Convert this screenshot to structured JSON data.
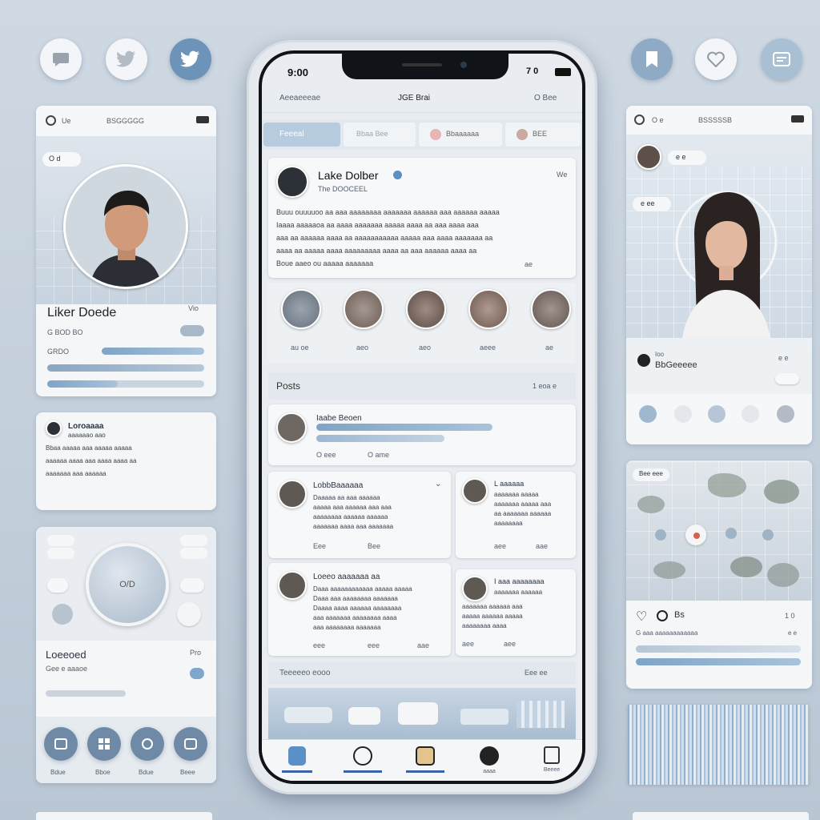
{
  "social_icons_left": [
    "chat-bubble-icon",
    "twitter-bird-icon",
    "twitter-bird-icon"
  ],
  "social_icons_right": [
    "bookmark-icon",
    "heart-icon",
    "message-icon"
  ],
  "left_profile": {
    "status_left": "Ue",
    "status_title": "BSGGGGG",
    "tag": "O d",
    "name": "Liker Doede",
    "name_meta": "Vio",
    "row1": "G BOD BO",
    "row2": "GRDO"
  },
  "left_post": {
    "name": "Loroaaaa",
    "lines": [
      "aaaaaao aao",
      "Bbaa aaaaa aaa aaaaa aaaaa",
      "aaaaaa aaaa aaa aaaa aaaa aa",
      "aaaaaaa aaa aaaaaa"
    ]
  },
  "left_media": {
    "label": "Loeeoed",
    "sub": "Gee e aaaoe",
    "meta": "Pro",
    "center_label": "O/D",
    "icons": [
      "play-icon",
      "grid-icon",
      "share-icon",
      "bookmark-icon"
    ],
    "icon_labels": [
      "Bdue",
      "Bboe",
      "Bdue",
      "Beee"
    ]
  },
  "phone": {
    "time": "9:00",
    "status_right": "7 0",
    "header_left": "Aeeaeeeae",
    "header_center": "JGE Brai",
    "header_right": "O Bee",
    "tabs": [
      "Feeeal",
      "Bbaa Bee",
      "Bbaaaaaa",
      "BEE"
    ],
    "post": {
      "author": "Lake Dolber",
      "subtitle": "The DOOCEEL",
      "time": "We",
      "lines": [
        "Buuu ouuuuoo aa aaa aaaaaaaa aaaaaaa aaaaaa aaa aaaaaa aaaaa",
        "Iaaaa aaaaaoa aa aaaa aaaaaaa aaaaa aaaa aa aaa aaaa aaa",
        "aaa aa aaaaaa aaaa aa aaaaaaaaaaa aaaaa aaa aaaa aaaaaaa aa",
        "aaaa aa aaaaa aaaa aaaaaaaaa aaaa aa aaa aaaaaa aaaa aa",
        "Boue aaeo ou aaaaa aaaaaaa"
      ],
      "action": "ae"
    },
    "stories": [
      "au oe",
      "aeo",
      "aeo",
      "aeee",
      "ae"
    ],
    "posts_label": "Posts",
    "posts_meta": "1 eoa e",
    "feed": [
      {
        "author": "Iaabe Beoen",
        "l1": "O eee",
        "l2": "O ame"
      },
      {
        "author": "LobbBaaaaaa",
        "lines": [
          "Daaaaa aa aaa aaaaaa",
          "aaaaa aaa aaaaaa aaa aaa",
          "aaaaaaaa aaaaaa aaaaaa",
          "aaaaaaa aaaa aaa aaaaaaa"
        ],
        "a1": "Eee",
        "a2": "Bee"
      },
      {
        "author": "L aaaaaa",
        "lines": [
          "aaaaaaa aaaaa",
          "aaaaaaa aaaaa aaa",
          "aa aaaaaaa aaaaaa",
          "aaaaaaaa"
        ],
        "a1": "aee",
        "a2": "aae"
      },
      {
        "author": "Loeeo aaaaaaa aa",
        "lines": [
          "Daaa aaaaaaaaaaaa aaaaa aaaaa",
          "Daaa aaa aaaaaaaa aaaaaaa",
          "Daaaa aaaa aaaaaa aaaaaaaa",
          "aaa aaaaaaa aaaaaaaa aaaa",
          "aaa aaaaaaaa aaaaaaa"
        ],
        "a1": "eee",
        "a2": "eee",
        "a3": "aae"
      },
      {
        "author": "I aaa aaaaaaaa",
        "lines": [
          "aaaaaaa aaaaaa",
          "aaaaaaa aaaaaa aaa",
          "aaaaa aaaaaa aaaaa",
          "aaaaaaaa aaaa"
        ],
        "a1": "aee",
        "a2": "aee"
      }
    ],
    "trending_label": "Teeeeeo eooo",
    "trending_meta": "Eee ee",
    "nav": [
      "home-icon",
      "explore-icon",
      "camera-icon",
      "heart-icon",
      "profile-icon"
    ],
    "nav_labels": [
      "",
      "",
      "",
      "aaaa",
      "Beeee"
    ]
  },
  "right_profile": {
    "status_left": "O e",
    "status_title": "BSSSSSB",
    "tag": "e e",
    "badge": "e ee",
    "name": "Ioo",
    "sub": "BbGeeeee",
    "meta": "e e",
    "icons": [
      "camera-icon",
      "image-icon",
      "link-icon",
      "like-icon",
      "settings-icon"
    ]
  },
  "right_gallery": {
    "label": "Bee eee",
    "likes": "Bs",
    "count": "1 0",
    "line1": "G aaa aaaaaaaaaaaa",
    "meta1": "e e"
  },
  "colors": {
    "accent": "#5b8fc7",
    "bar": "#8aadcf",
    "bg": "#c8d3de"
  }
}
